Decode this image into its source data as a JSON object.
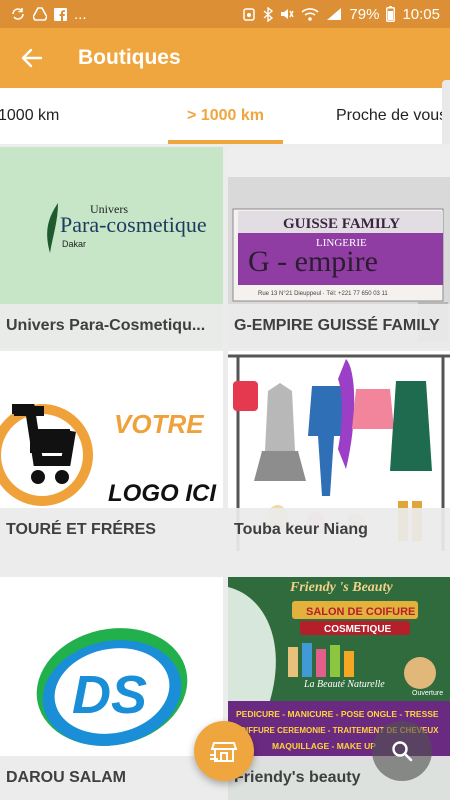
{
  "status_bar": {
    "notification_icons": [
      "sync-icon",
      "drive-icon",
      "facebook-icon"
    ],
    "overflow": "...",
    "battery": "79%",
    "time": "10:05"
  },
  "app_bar": {
    "title": "Boutiques"
  },
  "tabs": [
    {
      "label": "1000 km"
    },
    {
      "label": "> 1000 km",
      "active": true
    },
    {
      "label": "Proche de vous"
    }
  ],
  "colors": {
    "accent": "#f0a63e",
    "status": "#dc8f34",
    "label_bg": "#ebebeb"
  },
  "shops": [
    {
      "name": "Univers Para-Cosmetiqu...",
      "logo_line1": "Univers",
      "logo_line2": "Para-cosmetique",
      "logo_line3": "Dakar"
    },
    {
      "name": "G-EMPIRE GUISSÉ FAMILY",
      "sign_line1": "GUISSE FAMILY",
      "sign_line2": "LINGERIE",
      "sign_line3": "G - empire",
      "sign_line4": "Rue 13 N°21 Dieuppeul · Tél: +221 77 650 03 11"
    },
    {
      "name": "TOURÉ ET FRÉRES",
      "logo_line1": "VOTRE",
      "logo_line2": "LOGO ICI"
    },
    {
      "name": "Touba keur Niang"
    },
    {
      "name": "DAROU SALAM",
      "logo_text": "DS"
    },
    {
      "name": "Friendy's beauty",
      "sign_title": "Friendy 's Beauty",
      "sign_line1": "SALON DE COIFURE",
      "sign_line2": "COSMETIQUE",
      "sign_line3": "La Beauté Naturelle",
      "sign_line4": "PEDICURE - MANICURE - POSE ONGLE - TRESSE",
      "sign_line5": "COIFFURE CEREMONIE - TRAITEMENT DE CHEVEUX",
      "sign_line6": "MAQUILLAGE - MAKE UP",
      "sign_line7": "Ouverture"
    }
  ]
}
